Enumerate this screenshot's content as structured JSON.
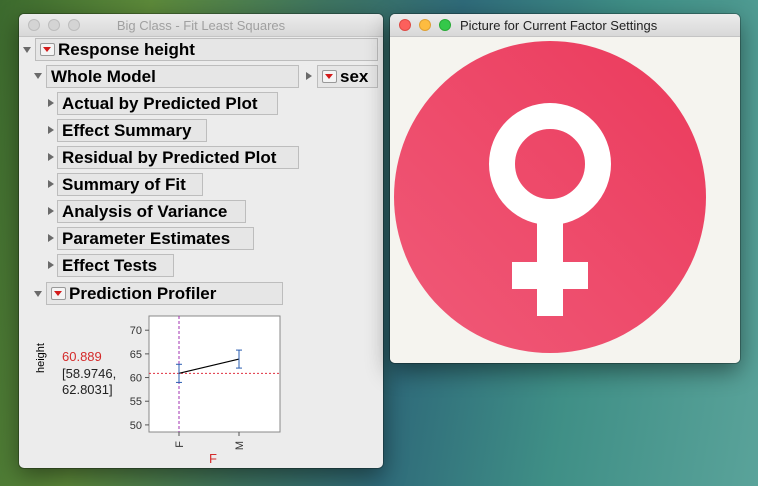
{
  "fit_window": {
    "title": "Big Class - Fit Least Squares",
    "response_header": "Response height",
    "whole_model_header": "Whole Model",
    "sex_header": "sex",
    "reports": [
      {
        "label": "Actual by Predicted Plot"
      },
      {
        "label": "Effect Summary"
      },
      {
        "label": "Residual by Predicted Plot"
      },
      {
        "label": "Summary of Fit"
      },
      {
        "label": "Analysis of Variance"
      },
      {
        "label": "Parameter Estimates"
      },
      {
        "label": "Effect Tests"
      }
    ],
    "profiler_header": "Prediction Profiler",
    "profiler": {
      "y_label": "height",
      "current_value": "60.889",
      "ci_line1": "[58.9746,",
      "ci_line2": "62.8031]",
      "factor_label": "F",
      "current_color": "#d42a2a"
    }
  },
  "chart_data": {
    "type": "line",
    "title": "",
    "xlabel": "F",
    "ylabel": "height",
    "categories": [
      "F",
      "M"
    ],
    "series": [
      {
        "values": [
          60.889,
          63.9
        ],
        "ci_low": [
          58.9746,
          62.0
        ],
        "ci_high": [
          62.8031,
          65.8
        ]
      }
    ],
    "yticks": [
      50,
      55,
      60,
      65,
      70
    ],
    "ylim": [
      48.5,
      73
    ],
    "current_x": "F",
    "current_y": 60.889,
    "grid": false
  },
  "picture_window": {
    "title": "Picture for Current Factor Settings",
    "symbol": "female-symbol",
    "symbol_color": "#ec3c62"
  }
}
